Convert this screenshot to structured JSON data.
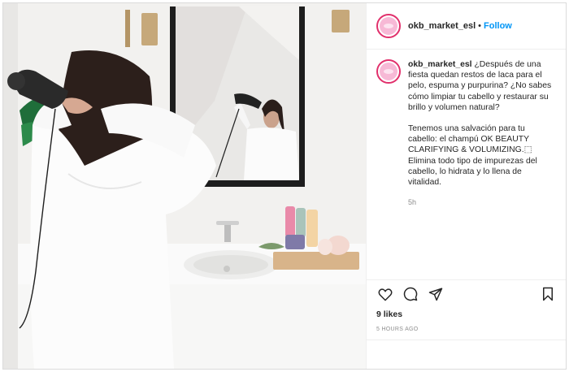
{
  "post": {
    "username": "okb_market_esl",
    "dot": "•",
    "follow_label": "Follow",
    "caption_paragraph_1": "¿Después de una fiesta quedan restos de laca para el pelo, espuma y purpurina? ¿No sabes cómo limpiar tu cabello y restaurar su brillo y volumen natural?",
    "caption_paragraph_2": "Tenemos una salvación para tu cabello: el champú OK BEAUTY CLARIFYING & VOLUMIZING.⬚ Elimina todo tipo de impurezas del cabello, lo hidrata y lo llena de vitalidad.",
    "relative_time": "5h",
    "likes": "9 likes",
    "timestamp": "5 HOURS AGO"
  },
  "icons": {
    "like": "heart-icon",
    "comment": "comment-icon",
    "share": "share-icon",
    "save": "bookmark-icon"
  },
  "colors": {
    "follow": "#0095f6",
    "avatar_ring": "#e1306c",
    "avatar_fill": "#f7b9d6",
    "muted_text": "#8e8e8e"
  }
}
